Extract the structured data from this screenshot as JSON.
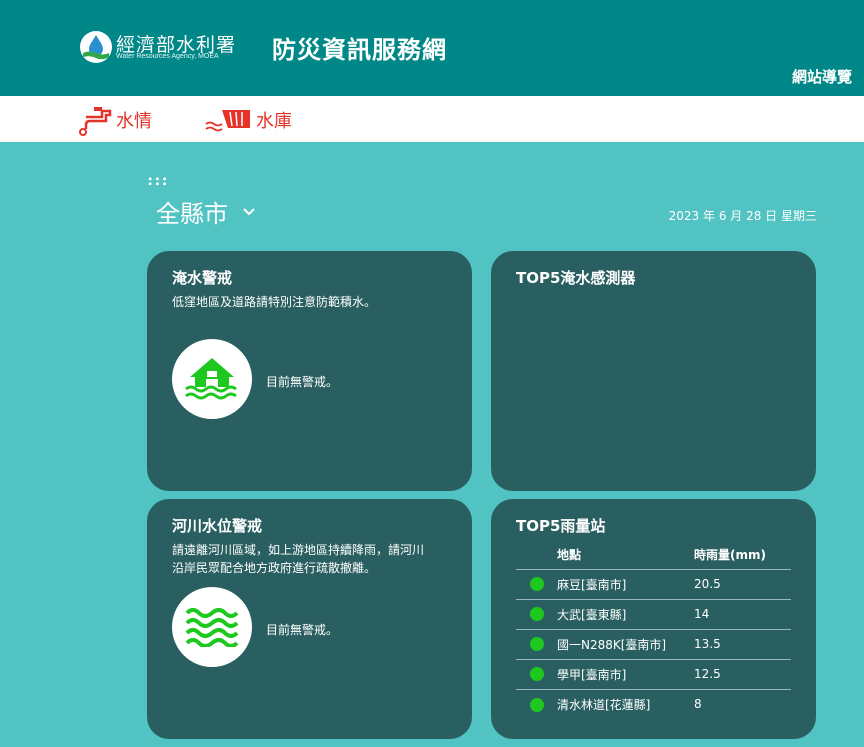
{
  "header": {
    "agency_name": "經濟部水利署",
    "agency_english": "Water Resources Agency, MOEA",
    "site_title": "防災資訊服務網",
    "sitemap_label": "網站導覽"
  },
  "nav": {
    "items": [
      {
        "label": "水情",
        "icon": "faucet-icon"
      },
      {
        "label": "水庫",
        "icon": "dam-icon"
      }
    ]
  },
  "filter": {
    "county": "全縣市",
    "date": "2023 年 6 月 28 日 星期三"
  },
  "cards": {
    "flood_warning": {
      "title": "淹水警戒",
      "description": "低窪地區及道路請特別注意防範積水。",
      "status": "目前無警戒。",
      "icon": "flooded-house-icon"
    },
    "flood_sensors": {
      "title": "TOP5淹水感測器"
    },
    "river_warning": {
      "title": "河川水位警戒",
      "description_lines": [
        "請遠離河川區域，如上游地區持續降雨，請河川",
        "沿岸民眾配合地方政府進行疏散撤離。"
      ],
      "status": "目前無警戒。",
      "icon": "waves-icon"
    },
    "rain_stations": {
      "title": "TOP5雨量站",
      "columns": [
        "地點",
        "時雨量(mm)"
      ],
      "rows": [
        {
          "location": "麻豆[臺南市]",
          "rainfall": "20.5"
        },
        {
          "location": "大武[臺東縣]",
          "rainfall": "14"
        },
        {
          "location": "國一N288K[臺南市]",
          "rainfall": "13.5"
        },
        {
          "location": "學甲[臺南市]",
          "rainfall": "12.5"
        },
        {
          "location": "清水林道[花蓮縣]",
          "rainfall": "8"
        }
      ],
      "status_color": "#1ec81e"
    }
  },
  "colors": {
    "header_bg": "#008787",
    "page_bg": "#52c3c3",
    "card_bg": "#2a5f61",
    "nav_accent": "#e5332a",
    "icon_green": "#1ec81e"
  }
}
